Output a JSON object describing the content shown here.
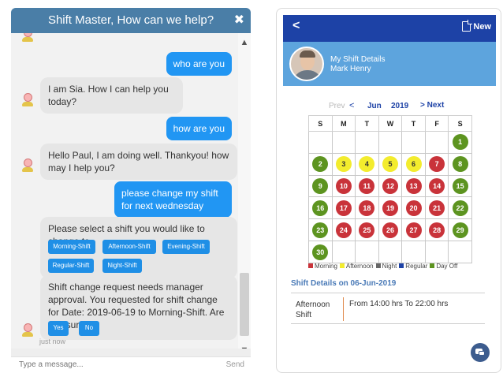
{
  "chat": {
    "title": "Shift Master, How can we help?",
    "close_icon": "close-icon",
    "messages": {
      "m1": "who are you",
      "m2": "I am Sia. How I can help you today?",
      "m3": "how are you",
      "m4": "Hello Paul, I am doing well. Thankyou! how may I help you?",
      "m5": "please change my shift for next wednesday",
      "m6": "Please select a shift you would like to change to",
      "m7": "Shift change request needs manager approval. You requested for shift change for Date: 2019-06-19 to Morning-Shift. Are you sure?"
    },
    "shift_options": [
      "Morning-Shift",
      "Afternoon-Shift",
      "Evening-Shift",
      "Regular-Shift",
      "Night-Shift"
    ],
    "confirm": {
      "yes": "Yes",
      "no": "No"
    },
    "timestamp": "just now",
    "input_placeholder": "Type a message...",
    "send_label": "Send"
  },
  "app": {
    "new_label": "New",
    "profile": {
      "title": "My Shift Details",
      "name": "Mark Henry"
    },
    "calendar": {
      "prev_label": "Prev",
      "month": "Jun",
      "year": "2019",
      "next_label": "Next",
      "weekdays": [
        "S",
        "M",
        "T",
        "W",
        "T",
        "F",
        "S"
      ],
      "days": [
        {
          "d": "1",
          "shift": "day_off"
        },
        {
          "d": "2",
          "shift": "day_off"
        },
        {
          "d": "3",
          "shift": "afternoon"
        },
        {
          "d": "4",
          "shift": "afternoon"
        },
        {
          "d": "5",
          "shift": "afternoon"
        },
        {
          "d": "6",
          "shift": "afternoon"
        },
        {
          "d": "7",
          "shift": "morning"
        },
        {
          "d": "8",
          "shift": "day_off"
        },
        {
          "d": "9",
          "shift": "day_off"
        },
        {
          "d": "10",
          "shift": "morning"
        },
        {
          "d": "11",
          "shift": "morning"
        },
        {
          "d": "12",
          "shift": "morning"
        },
        {
          "d": "13",
          "shift": "morning"
        },
        {
          "d": "14",
          "shift": "morning"
        },
        {
          "d": "15",
          "shift": "day_off"
        },
        {
          "d": "16",
          "shift": "day_off"
        },
        {
          "d": "17",
          "shift": "morning"
        },
        {
          "d": "18",
          "shift": "morning"
        },
        {
          "d": "19",
          "shift": "morning"
        },
        {
          "d": "20",
          "shift": "morning"
        },
        {
          "d": "21",
          "shift": "morning"
        },
        {
          "d": "22",
          "shift": "day_off"
        },
        {
          "d": "23",
          "shift": "day_off"
        },
        {
          "d": "24",
          "shift": "morning"
        },
        {
          "d": "25",
          "shift": "morning"
        },
        {
          "d": "26",
          "shift": "morning"
        },
        {
          "d": "27",
          "shift": "morning"
        },
        {
          "d": "28",
          "shift": "morning"
        },
        {
          "d": "29",
          "shift": "day_off"
        },
        {
          "d": "30",
          "shift": "day_off"
        }
      ],
      "colors": {
        "morning": "#c9333a",
        "afternoon": "#f3ec2d",
        "night": "#666666",
        "regular": "#1d42a6",
        "day_off": "#5d9420"
      }
    },
    "legend": [
      {
        "label": "Morning",
        "key": "morning"
      },
      {
        "label": "Afternoon",
        "key": "afternoon"
      },
      {
        "label": "Night",
        "key": "night"
      },
      {
        "label": "Regular",
        "key": "regular"
      },
      {
        "label": "Day Off",
        "key": "day_off"
      }
    ],
    "details": {
      "title": "Shift Details on 06-Jun-2019",
      "shift_name": "Afternoon Shift",
      "shift_time": "From 14:00 hrs To 22:00 hrs"
    }
  }
}
